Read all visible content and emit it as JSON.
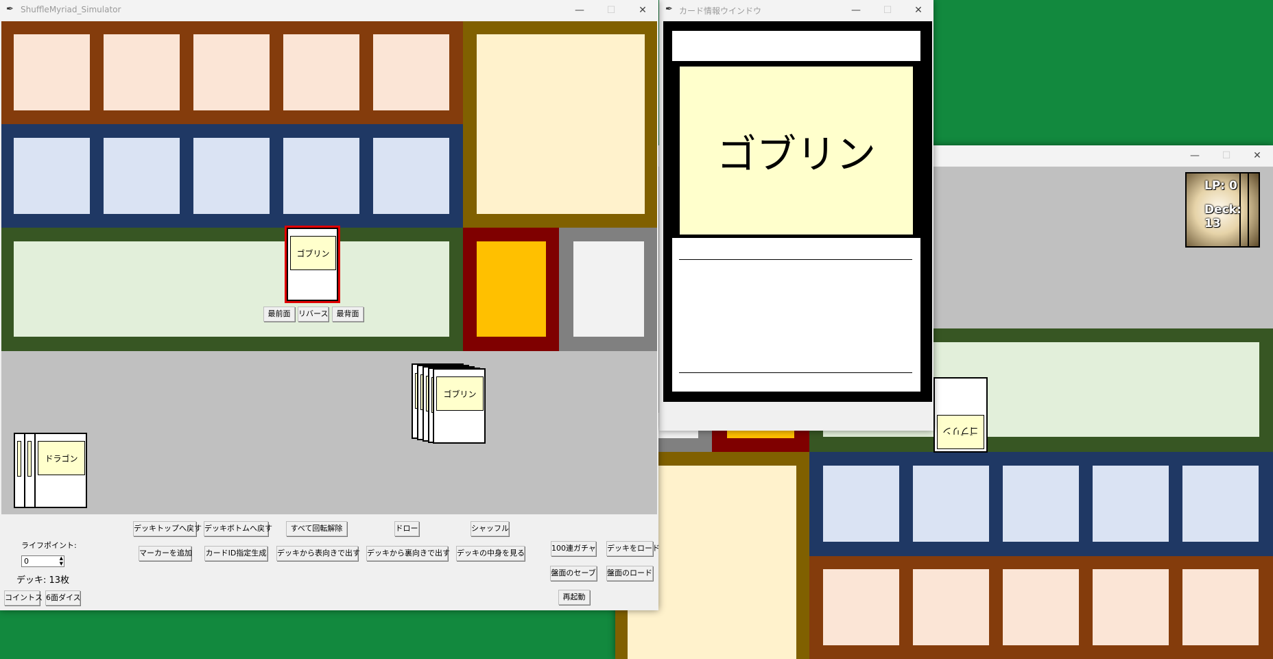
{
  "colors": {
    "desktop": "#12893e",
    "brown": "#843c0c",
    "blue": "#1f3864",
    "green": "#375623",
    "olive": "#806000",
    "red": "#7f0000",
    "gray": "#808080",
    "cardname": "#ffffcc"
  },
  "main_window": {
    "title": "ShuffleMyriad_Simulator",
    "icon": "feather-icon",
    "controls": {
      "minimize": "—",
      "maximize": "☐",
      "close": "✕"
    },
    "card_in_play": {
      "name": "ゴブリン"
    },
    "card_actions": [
      "最前面",
      "リバース",
      "最背面"
    ],
    "deck_stack_top": {
      "name": "ゴブリン"
    },
    "grave_stack_top": {
      "name": "ドラゴン"
    },
    "buttons_row1": [
      "デッキトップへ戻す",
      "デッキボトムへ戻す",
      "すべて回転解除",
      "ドロー",
      "シャッフル"
    ],
    "buttons_row2": [
      "マーカーを追加",
      "カードID指定生成",
      "デッキから表向きで出す",
      "デッキから裏向きで出す",
      "デッキの中身を見る"
    ],
    "right_buttons": [
      "100連ガチャ",
      "デッキをロード",
      "盤面のセーブ",
      "盤面のロード",
      "再起動"
    ],
    "life_label": "ライフポイント:",
    "life_value": "0",
    "deck_count": "デッキ: 13枚",
    "bottom_buttons": [
      "コイントス",
      "6面ダイス"
    ]
  },
  "info_window": {
    "title": "カード情報ウインドウ",
    "card_name": "ゴブリン"
  },
  "opponent_window": {
    "lp": "LP: 0",
    "deck": "Deck: 13",
    "card_name": "ゴブリン"
  }
}
